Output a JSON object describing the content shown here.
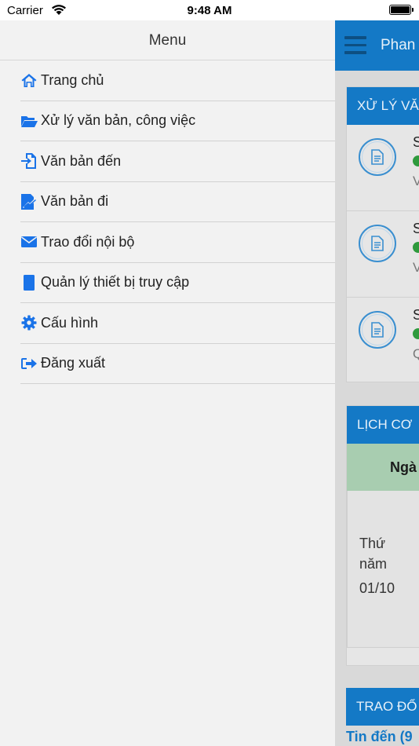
{
  "status_bar": {
    "carrier": "Carrier",
    "time": "9:48 AM"
  },
  "menu": {
    "title": "Menu",
    "items": [
      {
        "label": "Trang chủ",
        "icon": "home-icon"
      },
      {
        "label": "Xử lý văn bản, công việc",
        "icon": "folder-open-icon"
      },
      {
        "label": "Văn bản đến",
        "icon": "incoming-document-icon"
      },
      {
        "label": "Văn bản đi",
        "icon": "outgoing-document-icon"
      },
      {
        "label": "Trao đổi nội bộ",
        "icon": "envelope-icon"
      },
      {
        "label": "Quản lý thiết bị truy cập",
        "icon": "device-icon"
      },
      {
        "label": "Cấu hình",
        "icon": "gear-icon"
      },
      {
        "label": "Đăng xuất",
        "icon": "sign-out-icon"
      }
    ]
  },
  "app": {
    "title": "Phan",
    "sections": {
      "processing": {
        "header": "XỬ LÝ VĂ",
        "rows": [
          {
            "line1": "S",
            "line3": "V"
          },
          {
            "line1": "S",
            "line3": "V"
          },
          {
            "line1": "S",
            "line3": "Q"
          }
        ]
      },
      "schedule": {
        "header": "LỊCH CƠ",
        "column_header": "Ngà",
        "day_label": "Thứ năm",
        "date": "01/10"
      },
      "exchange": {
        "header": "TRAO ĐỔ",
        "link": "Tin đến (9"
      }
    }
  },
  "colors": {
    "accent": "#1479c6",
    "menu_icon": "#1a73e8",
    "status_green": "#2f9a3d",
    "table_header_bg": "#a8cdb0"
  }
}
